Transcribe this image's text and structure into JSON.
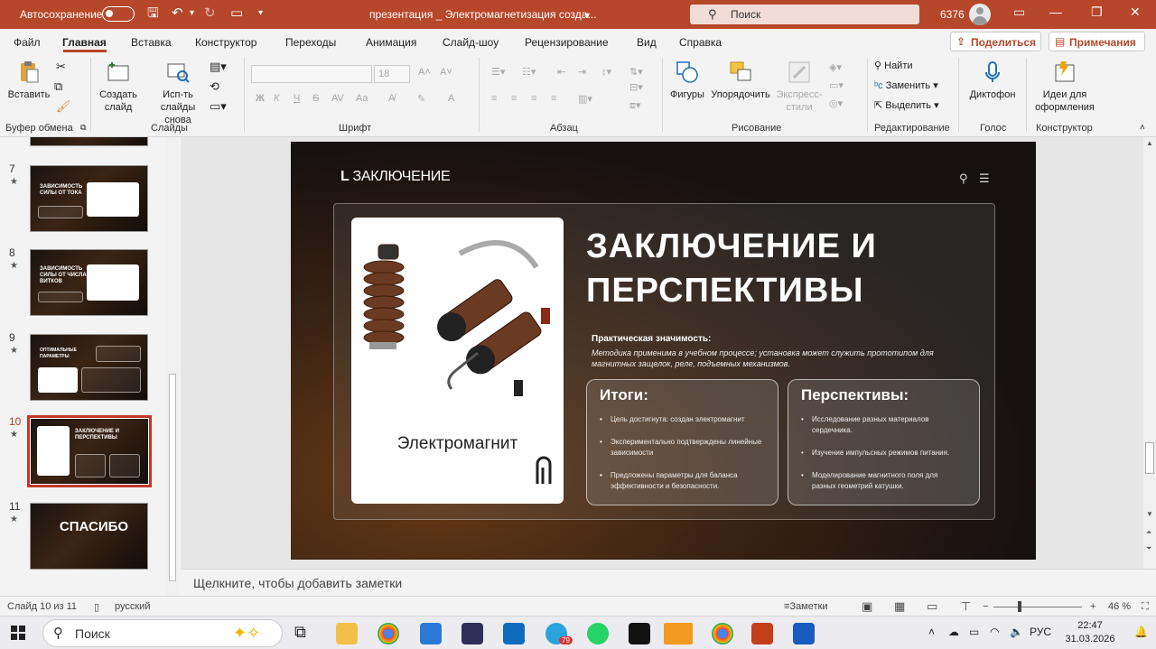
{
  "titlebar": {
    "autosave_label": "Автосохранение",
    "doc_title": "презентация _ Электромагнетизация созда...",
    "search_label": "Поиск",
    "user_number": "6376"
  },
  "menu": {
    "items": [
      "Файл",
      "Главная",
      "Вставка",
      "Конструктор",
      "Переходы",
      "Анимация",
      "Слайд-шоу",
      "Рецензирование",
      "Вид",
      "Справка"
    ],
    "share": "Поделиться",
    "comments": "Примечания"
  },
  "ribbon": {
    "paste": "Вставить",
    "new_slide_1": "Создать",
    "new_slide_2": "слайд",
    "reuse_1": "Исп-ть",
    "reuse_2": "слайды снова",
    "font_size": "18",
    "shapes": "Фигуры",
    "arrange": "Упорядочить",
    "styles_1": "Экспресс-",
    "styles_2": "стили",
    "find": "Найти",
    "replace": "Заменить",
    "select": "Выделить",
    "dictate": "Диктофон",
    "designer_1": "Идеи для",
    "designer_2": "оформления",
    "bold": "Ж",
    "italic": "К",
    "underline": "Ч",
    "strike": "S",
    "groups": {
      "clipboard": "Буфер обмена",
      "slides": "Слайды",
      "font": "Шрифт",
      "paragraph": "Абзац",
      "drawing": "Рисование",
      "editing": "Редактирование",
      "voice": "Голос",
      "designer": "Конструктор"
    }
  },
  "thumbnails": [
    {
      "num": "7",
      "star": "★",
      "title": "ЗАВИСИМОСТЬ СИЛЫ ОТ ТОКА"
    },
    {
      "num": "8",
      "star": "★",
      "title": "ЗАВИСИМОСТЬ СИЛЫ ОТ ЧИСЛА ВИТКОВ"
    },
    {
      "num": "9",
      "star": "★",
      "title": "ОПТИМАЛЬНЫЕ ПАРАМЕТРЫ"
    },
    {
      "num": "10",
      "star": "★",
      "title": "ЗАКЛЮЧЕНИЕ И ПЕРСПЕКТИВЫ"
    },
    {
      "num": "11",
      "star": "★",
      "title": "СПАСИБО"
    }
  ],
  "slide": {
    "header": "ЗАКЛЮЧЕНИЕ",
    "image_caption": "Электромагнит",
    "title_line1": "ЗАКЛЮЧЕНИЕ И",
    "title_line2": "ПЕРСПЕКТИВЫ",
    "significance_heading": "Практическая значимость:",
    "significance_text": "Методика применима в учебном процессе; установка может служить прототипом для магнитных защелок, реле, подъемных механизмов.",
    "results": {
      "heading": "Итоги:",
      "items": [
        "Цель достигнута: создан электромагнит",
        "Экспериментально подтверждены линейные зависимости",
        "Предложены параметры для баланса эффективности и безопасности."
      ]
    },
    "prospects": {
      "heading": "Перспективы:",
      "items": [
        "Исследование разных материалов сердечника.",
        "Изучение импульсных режимов питания.",
        "Моделирование магнитного поля для разных геометрий катушки."
      ]
    }
  },
  "notes_placeholder": "Щелкните, чтобы добавить заметки",
  "status": {
    "slide_info": "Слайд 10 из 11",
    "language": "русский",
    "notes_btn": "Заметки",
    "zoom": "46 %"
  },
  "taskbar": {
    "search": "Поиск",
    "lang": "РУС",
    "time": "22:47",
    "date": "31.03.2026",
    "telegram_badge": "79"
  }
}
